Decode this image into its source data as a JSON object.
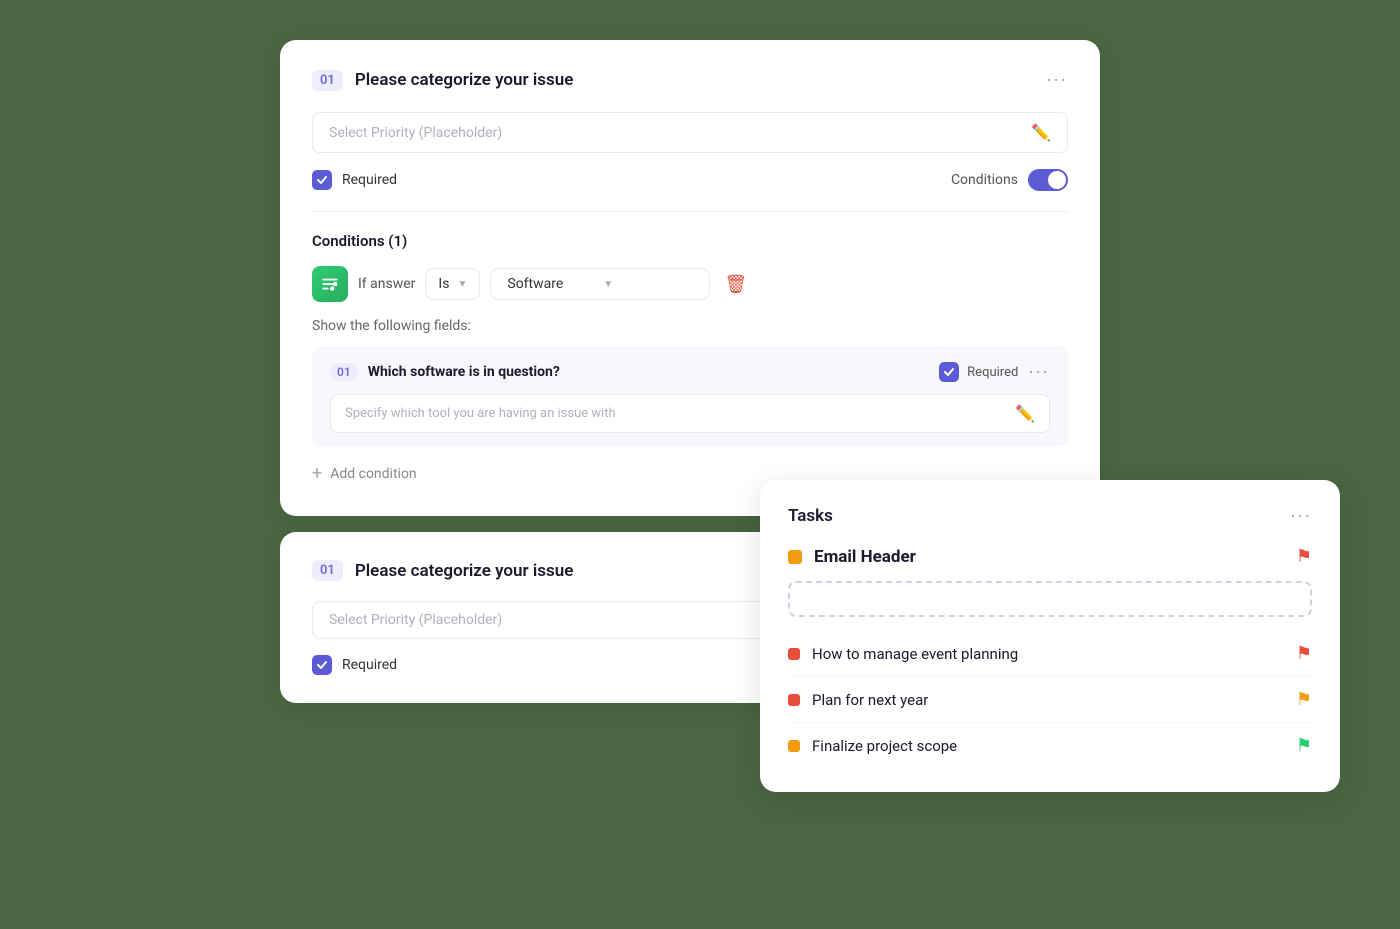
{
  "card1": {
    "step": "01",
    "title": "Please categorize your issue",
    "placeholder": "Select Priority (Placeholder)",
    "required_label": "Required",
    "conditions_label": "Conditions",
    "conditions_count_label": "Conditions (1)",
    "if_answer_label": "If answer",
    "condition_operator": "Is",
    "condition_value": "Software",
    "show_fields_label": "Show the following fields:",
    "nested_step": "01",
    "nested_title": "Which software is in question?",
    "nested_required": "Required",
    "nested_placeholder": "Specify which tool you are having an issue with",
    "add_condition_label": "Add condition",
    "more_icon": "···",
    "more_icon_nested": "···"
  },
  "card2": {
    "step": "01",
    "title": "Please categorize your issue",
    "placeholder": "Select Priority (Placeholder)",
    "required_label": "Required"
  },
  "tasks": {
    "title": "Tasks",
    "more_icon": "···",
    "email_header": "Email Header",
    "items": [
      {
        "name": "How to manage event planning",
        "dot_color": "red",
        "flag_color": "red"
      },
      {
        "name": "Plan for next year",
        "dot_color": "red",
        "flag_color": "yellow"
      },
      {
        "name": "Finalize project scope",
        "dot_color": "yellow",
        "flag_color": "green"
      }
    ]
  }
}
